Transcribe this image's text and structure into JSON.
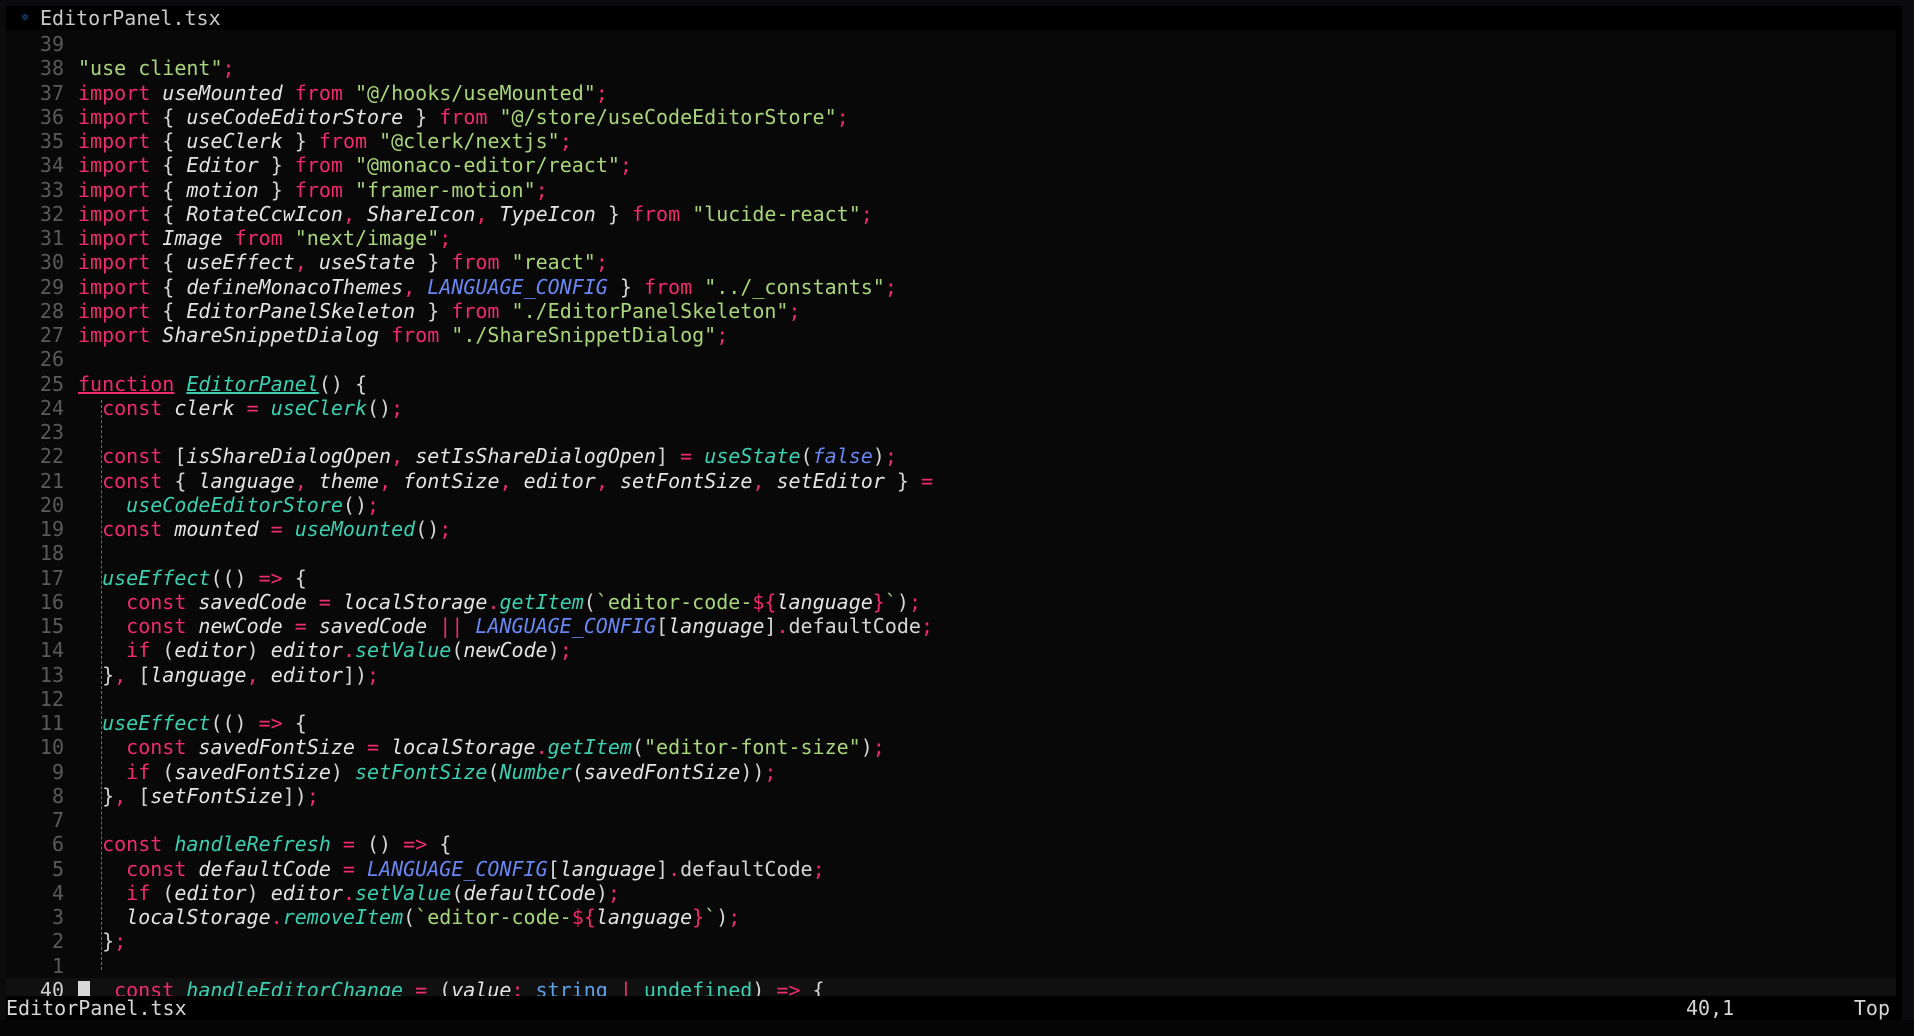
{
  "tab": {
    "title": "EditorPanel.tsx",
    "icon": "typescript-file-icon"
  },
  "status": {
    "filename": "EditorPanel.tsx",
    "position": "40,1",
    "scroll": "Top"
  },
  "colors": {
    "keyword": "#ee2b6b",
    "string": "#a9d67c",
    "function": "#3ccfb0",
    "constant": "#6a86f0",
    "type": "#5fa0e6",
    "identifier": "#e4e4e4",
    "line_number": "#5a5a5a",
    "background": "#080808"
  },
  "lines": [
    {
      "num": "39",
      "tokens": []
    },
    {
      "num": "38",
      "tokens": [
        [
          "str",
          "\"use client\""
        ],
        [
          "kw",
          ";"
        ]
      ]
    },
    {
      "num": "37",
      "tokens": [
        [
          "kw",
          "import "
        ],
        [
          "id",
          "useMounted "
        ],
        [
          "kw",
          "from "
        ],
        [
          "str",
          "\"@/hooks/useMounted\""
        ],
        [
          "kw",
          ";"
        ]
      ]
    },
    {
      "num": "36",
      "tokens": [
        [
          "kw",
          "import "
        ],
        [
          "plain",
          "{ "
        ],
        [
          "id",
          "useCodeEditorStore "
        ],
        [
          "plain",
          "} "
        ],
        [
          "kw",
          "from "
        ],
        [
          "str",
          "\"@/store/useCodeEditorStore\""
        ],
        [
          "kw",
          ";"
        ]
      ]
    },
    {
      "num": "35",
      "tokens": [
        [
          "kw",
          "import "
        ],
        [
          "plain",
          "{ "
        ],
        [
          "id",
          "useClerk "
        ],
        [
          "plain",
          "} "
        ],
        [
          "kw",
          "from "
        ],
        [
          "str",
          "\"@clerk/nextjs\""
        ],
        [
          "kw",
          ";"
        ]
      ]
    },
    {
      "num": "34",
      "tokens": [
        [
          "kw",
          "import "
        ],
        [
          "plain",
          "{ "
        ],
        [
          "id",
          "Editor "
        ],
        [
          "plain",
          "} "
        ],
        [
          "kw",
          "from "
        ],
        [
          "str",
          "\"@monaco-editor/react\""
        ],
        [
          "kw",
          ";"
        ]
      ]
    },
    {
      "num": "33",
      "tokens": [
        [
          "kw",
          "import "
        ],
        [
          "plain",
          "{ "
        ],
        [
          "id",
          "motion "
        ],
        [
          "plain",
          "} "
        ],
        [
          "kw",
          "from "
        ],
        [
          "str",
          "\"framer-motion\""
        ],
        [
          "kw",
          ";"
        ]
      ]
    },
    {
      "num": "32",
      "tokens": [
        [
          "kw",
          "import "
        ],
        [
          "plain",
          "{ "
        ],
        [
          "id",
          "RotateCcwIcon"
        ],
        [
          "kw",
          ", "
        ],
        [
          "id",
          "ShareIcon"
        ],
        [
          "kw",
          ", "
        ],
        [
          "id",
          "TypeIcon "
        ],
        [
          "plain",
          "} "
        ],
        [
          "kw",
          "from "
        ],
        [
          "str",
          "\"lucide-react\""
        ],
        [
          "kw",
          ";"
        ]
      ]
    },
    {
      "num": "31",
      "tokens": [
        [
          "kw",
          "import "
        ],
        [
          "id",
          "Image "
        ],
        [
          "kw",
          "from "
        ],
        [
          "str",
          "\"next/image\""
        ],
        [
          "kw",
          ";"
        ]
      ]
    },
    {
      "num": "30",
      "tokens": [
        [
          "kw",
          "import "
        ],
        [
          "plain",
          "{ "
        ],
        [
          "id",
          "useEffect"
        ],
        [
          "kw",
          ", "
        ],
        [
          "id",
          "useState "
        ],
        [
          "plain",
          "} "
        ],
        [
          "kw",
          "from "
        ],
        [
          "str",
          "\"react\""
        ],
        [
          "kw",
          ";"
        ]
      ]
    },
    {
      "num": "29",
      "tokens": [
        [
          "kw",
          "import "
        ],
        [
          "plain",
          "{ "
        ],
        [
          "id",
          "defineMonacoThemes"
        ],
        [
          "kw",
          ", "
        ],
        [
          "const",
          "LANGUAGE_CONFIG "
        ],
        [
          "plain",
          "} "
        ],
        [
          "kw",
          "from "
        ],
        [
          "str",
          "\"../_constants\""
        ],
        [
          "kw",
          ";"
        ]
      ]
    },
    {
      "num": "28",
      "tokens": [
        [
          "kw",
          "import "
        ],
        [
          "plain",
          "{ "
        ],
        [
          "id",
          "EditorPanelSkeleton "
        ],
        [
          "plain",
          "} "
        ],
        [
          "kw",
          "from "
        ],
        [
          "str",
          "\"./EditorPanelSkeleton\""
        ],
        [
          "kw",
          ";"
        ]
      ]
    },
    {
      "num": "27",
      "tokens": [
        [
          "kw",
          "import "
        ],
        [
          "id",
          "ShareSnippetDialog "
        ],
        [
          "kw",
          "from "
        ],
        [
          "str",
          "\"./ShareSnippetDialog\""
        ],
        [
          "kw",
          ";"
        ]
      ]
    },
    {
      "num": "26",
      "tokens": []
    },
    {
      "num": "25",
      "tokens": [
        [
          "kwu",
          "function"
        ],
        [
          "plain",
          " "
        ],
        [
          "fnu",
          "EditorPanel"
        ],
        [
          "plain",
          "() {"
        ]
      ]
    },
    {
      "num": "24",
      "tokens": [
        [
          "plain",
          "  "
        ],
        [
          "kw",
          "const "
        ],
        [
          "id",
          "clerk "
        ],
        [
          "kw",
          "= "
        ],
        [
          "fn",
          "useClerk"
        ],
        [
          "plain",
          "()"
        ],
        [
          "kw",
          ";"
        ]
      ]
    },
    {
      "num": "23",
      "tokens": []
    },
    {
      "num": "22",
      "tokens": [
        [
          "plain",
          "  "
        ],
        [
          "kw",
          "const "
        ],
        [
          "plain",
          "["
        ],
        [
          "id",
          "isShareDialogOpen"
        ],
        [
          "kw",
          ", "
        ],
        [
          "id",
          "setIsShareDialogOpen"
        ],
        [
          "plain",
          "] "
        ],
        [
          "kw",
          "= "
        ],
        [
          "fn",
          "useState"
        ],
        [
          "plain",
          "("
        ],
        [
          "const",
          "false"
        ],
        [
          "plain",
          ")"
        ],
        [
          "kw",
          ";"
        ]
      ]
    },
    {
      "num": "21",
      "tokens": [
        [
          "plain",
          "  "
        ],
        [
          "kw",
          "const "
        ],
        [
          "plain",
          "{ "
        ],
        [
          "id",
          "language"
        ],
        [
          "kw",
          ", "
        ],
        [
          "id",
          "theme"
        ],
        [
          "kw",
          ", "
        ],
        [
          "id",
          "fontSize"
        ],
        [
          "kw",
          ", "
        ],
        [
          "id",
          "editor"
        ],
        [
          "kw",
          ", "
        ],
        [
          "id",
          "setFontSize"
        ],
        [
          "kw",
          ", "
        ],
        [
          "id",
          "setEditor "
        ],
        [
          "plain",
          "} "
        ],
        [
          "kw",
          "="
        ]
      ]
    },
    {
      "num": "20",
      "tokens": [
        [
          "plain",
          "    "
        ],
        [
          "fn",
          "useCodeEditorStore"
        ],
        [
          "plain",
          "()"
        ],
        [
          "kw",
          ";"
        ]
      ]
    },
    {
      "num": "19",
      "tokens": [
        [
          "plain",
          "  "
        ],
        [
          "kw",
          "const "
        ],
        [
          "id",
          "mounted "
        ],
        [
          "kw",
          "= "
        ],
        [
          "fn",
          "useMounted"
        ],
        [
          "plain",
          "()"
        ],
        [
          "kw",
          ";"
        ]
      ]
    },
    {
      "num": "18",
      "tokens": []
    },
    {
      "num": "17",
      "tokens": [
        [
          "plain",
          "  "
        ],
        [
          "fn",
          "useEffect"
        ],
        [
          "plain",
          "(() "
        ],
        [
          "kw",
          "=> "
        ],
        [
          "plain",
          "{"
        ]
      ]
    },
    {
      "num": "16",
      "tokens": [
        [
          "plain",
          "    "
        ],
        [
          "kw",
          "const "
        ],
        [
          "id",
          "savedCode "
        ],
        [
          "kw",
          "= "
        ],
        [
          "id",
          "localStorage"
        ],
        [
          "kw",
          "."
        ],
        [
          "fn",
          "getItem"
        ],
        [
          "plain",
          "("
        ],
        [
          "str",
          "`editor-code-"
        ],
        [
          "kw",
          "${"
        ],
        [
          "id",
          "language"
        ],
        [
          "kw",
          "}"
        ],
        [
          "str",
          "`"
        ],
        [
          "plain",
          ")"
        ],
        [
          "kw",
          ";"
        ]
      ]
    },
    {
      "num": "15",
      "tokens": [
        [
          "plain",
          "    "
        ],
        [
          "kw",
          "const "
        ],
        [
          "id",
          "newCode "
        ],
        [
          "kw",
          "= "
        ],
        [
          "id",
          "savedCode "
        ],
        [
          "kw",
          "|| "
        ],
        [
          "const",
          "LANGUAGE_CONFIG"
        ],
        [
          "plain",
          "["
        ],
        [
          "id",
          "language"
        ],
        [
          "plain",
          "]"
        ],
        [
          "kw",
          "."
        ],
        [
          "plain",
          "defaultCode"
        ],
        [
          "kw",
          ";"
        ]
      ]
    },
    {
      "num": "14",
      "tokens": [
        [
          "plain",
          "    "
        ],
        [
          "kw",
          "if "
        ],
        [
          "plain",
          "("
        ],
        [
          "id",
          "editor"
        ],
        [
          "plain",
          ") "
        ],
        [
          "id",
          "editor"
        ],
        [
          "kw",
          "."
        ],
        [
          "fn",
          "setValue"
        ],
        [
          "plain",
          "("
        ],
        [
          "id",
          "newCode"
        ],
        [
          "plain",
          ")"
        ],
        [
          "kw",
          ";"
        ]
      ]
    },
    {
      "num": "13",
      "tokens": [
        [
          "plain",
          "  }"
        ],
        [
          "kw",
          ", "
        ],
        [
          "plain",
          "["
        ],
        [
          "id",
          "language"
        ],
        [
          "kw",
          ", "
        ],
        [
          "id",
          "editor"
        ],
        [
          "plain",
          "])"
        ],
        [
          "kw",
          ";"
        ]
      ]
    },
    {
      "num": "12",
      "tokens": []
    },
    {
      "num": "11",
      "tokens": [
        [
          "plain",
          "  "
        ],
        [
          "fn",
          "useEffect"
        ],
        [
          "plain",
          "(() "
        ],
        [
          "kw",
          "=> "
        ],
        [
          "plain",
          "{"
        ]
      ]
    },
    {
      "num": "10",
      "tokens": [
        [
          "plain",
          "    "
        ],
        [
          "kw",
          "const "
        ],
        [
          "id",
          "savedFontSize "
        ],
        [
          "kw",
          "= "
        ],
        [
          "id",
          "localStorage"
        ],
        [
          "kw",
          "."
        ],
        [
          "fn",
          "getItem"
        ],
        [
          "plain",
          "("
        ],
        [
          "str",
          "\"editor-font-size\""
        ],
        [
          "plain",
          ")"
        ],
        [
          "kw",
          ";"
        ]
      ]
    },
    {
      "num": "9",
      "tokens": [
        [
          "plain",
          "    "
        ],
        [
          "kw",
          "if "
        ],
        [
          "plain",
          "("
        ],
        [
          "id",
          "savedFontSize"
        ],
        [
          "plain",
          ") "
        ],
        [
          "fn",
          "setFontSize"
        ],
        [
          "plain",
          "("
        ],
        [
          "fn",
          "Number"
        ],
        [
          "plain",
          "("
        ],
        [
          "id",
          "savedFontSize"
        ],
        [
          "plain",
          "))"
        ],
        [
          "kw",
          ";"
        ]
      ]
    },
    {
      "num": "8",
      "tokens": [
        [
          "plain",
          "  }"
        ],
        [
          "kw",
          ", "
        ],
        [
          "plain",
          "["
        ],
        [
          "id",
          "setFontSize"
        ],
        [
          "plain",
          "])"
        ],
        [
          "kw",
          ";"
        ]
      ]
    },
    {
      "num": "7",
      "tokens": []
    },
    {
      "num": "6",
      "tokens": [
        [
          "plain",
          "  "
        ],
        [
          "kw",
          "const "
        ],
        [
          "fn",
          "handleRefresh "
        ],
        [
          "kw",
          "= "
        ],
        [
          "plain",
          "() "
        ],
        [
          "kw",
          "=> "
        ],
        [
          "plain",
          "{"
        ]
      ]
    },
    {
      "num": "5",
      "tokens": [
        [
          "plain",
          "    "
        ],
        [
          "kw",
          "const "
        ],
        [
          "id",
          "defaultCode "
        ],
        [
          "kw",
          "= "
        ],
        [
          "const",
          "LANGUAGE_CONFIG"
        ],
        [
          "plain",
          "["
        ],
        [
          "id",
          "language"
        ],
        [
          "plain",
          "]"
        ],
        [
          "kw",
          "."
        ],
        [
          "plain",
          "defaultCode"
        ],
        [
          "kw",
          ";"
        ]
      ]
    },
    {
      "num": "4",
      "tokens": [
        [
          "plain",
          "    "
        ],
        [
          "kw",
          "if "
        ],
        [
          "plain",
          "("
        ],
        [
          "id",
          "editor"
        ],
        [
          "plain",
          ") "
        ],
        [
          "id",
          "editor"
        ],
        [
          "kw",
          "."
        ],
        [
          "fn",
          "setValue"
        ],
        [
          "plain",
          "("
        ],
        [
          "id",
          "defaultCode"
        ],
        [
          "plain",
          ")"
        ],
        [
          "kw",
          ";"
        ]
      ]
    },
    {
      "num": "3",
      "tokens": [
        [
          "plain",
          "    "
        ],
        [
          "id",
          "localStorage"
        ],
        [
          "kw",
          "."
        ],
        [
          "fn",
          "removeItem"
        ],
        [
          "plain",
          "("
        ],
        [
          "str",
          "`editor-code-"
        ],
        [
          "kw",
          "${"
        ],
        [
          "id",
          "language"
        ],
        [
          "kw",
          "}"
        ],
        [
          "str",
          "`"
        ],
        [
          "plain",
          ")"
        ],
        [
          "kw",
          ";"
        ]
      ]
    },
    {
      "num": "2",
      "tokens": [
        [
          "plain",
          "  }"
        ],
        [
          "kw",
          ";"
        ]
      ]
    },
    {
      "num": "1",
      "tokens": []
    },
    {
      "num": "40",
      "current": true,
      "tokens": [
        [
          "plain",
          " "
        ],
        [
          "kw",
          "const "
        ],
        [
          "fn",
          "handleEditorChange "
        ],
        [
          "kw",
          "= "
        ],
        [
          "plain",
          "("
        ],
        [
          "id",
          "value"
        ],
        [
          "kw",
          ": "
        ],
        [
          "ty",
          "string "
        ],
        [
          "kw",
          "| "
        ],
        [
          "undef",
          "undefined"
        ],
        [
          "plain",
          ") "
        ],
        [
          "kw",
          "=> "
        ],
        [
          "plain",
          "{"
        ]
      ]
    }
  ]
}
